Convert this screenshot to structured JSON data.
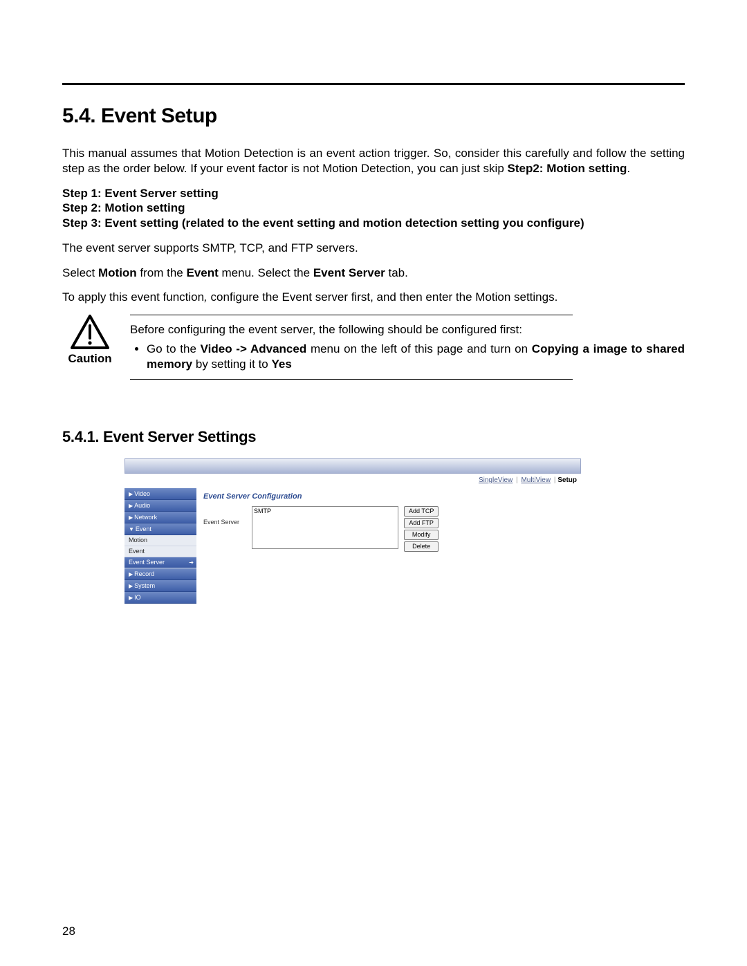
{
  "heading": "5.4. Event Setup",
  "intro": "This manual assumes that Motion Detection is an event action trigger.  So, consider this carefully and follow the setting step as the order below.  If your event factor is not Motion Detection, you can just skip ",
  "intro_bold_tail": "Step2: Motion setting",
  "intro_period": ".",
  "steps": {
    "s1": "Step 1: Event Server setting",
    "s2": "Step 2: Motion setting",
    "s3": "Step 3: Event setting (related to the event setting and motion detection setting you configure)"
  },
  "p_smtp": "The event server supports SMTP, TCP, and FTP servers.",
  "p_select_pre": "Select ",
  "p_select_motion": "Motion",
  "p_select_mid1": " from the ",
  "p_select_event": "Event",
  "p_select_mid2": " menu.    Select the ",
  "p_select_server": "Event Server",
  "p_select_tail": " tab.",
  "p_apply_pre": "To apply this event function",
  "p_apply_comma_italic": ",",
  "p_apply_tail": " configure the Event server first, and then enter the Motion settings.",
  "caution_label": "Caution",
  "caution_line1": "Before configuring the event server, the  following should be configured first:",
  "caution_li_pre": "Go to the ",
  "caution_li_bold1": "Video -> Advanced",
  "caution_li_mid": " menu on the left of this page and turn on ",
  "caution_li_bold2": "Copying a image to shared memory",
  "caution_li_mid2": " by setting it to ",
  "caution_li_bold3": "Yes",
  "subheading": "5.4.1. Event Server Settings",
  "ui": {
    "tabs": {
      "single": "SingleView",
      "multi": "MultiView",
      "setup": "Setup"
    },
    "nav": {
      "video": "Video",
      "audio": "Audio",
      "network": "Network",
      "event": "Event",
      "motion": "Motion",
      "event_sub": "Event",
      "event_server": "Event Server",
      "record": "Record",
      "system": "System",
      "io": "IO"
    },
    "panel_title": "Event Server Configuration",
    "row_label": "Event Server",
    "list_item": "SMTP",
    "buttons": {
      "add_tcp": "Add TCP",
      "add_ftp": "Add FTP",
      "modify": "Modify",
      "delete": "Delete"
    }
  },
  "page_number": "28"
}
